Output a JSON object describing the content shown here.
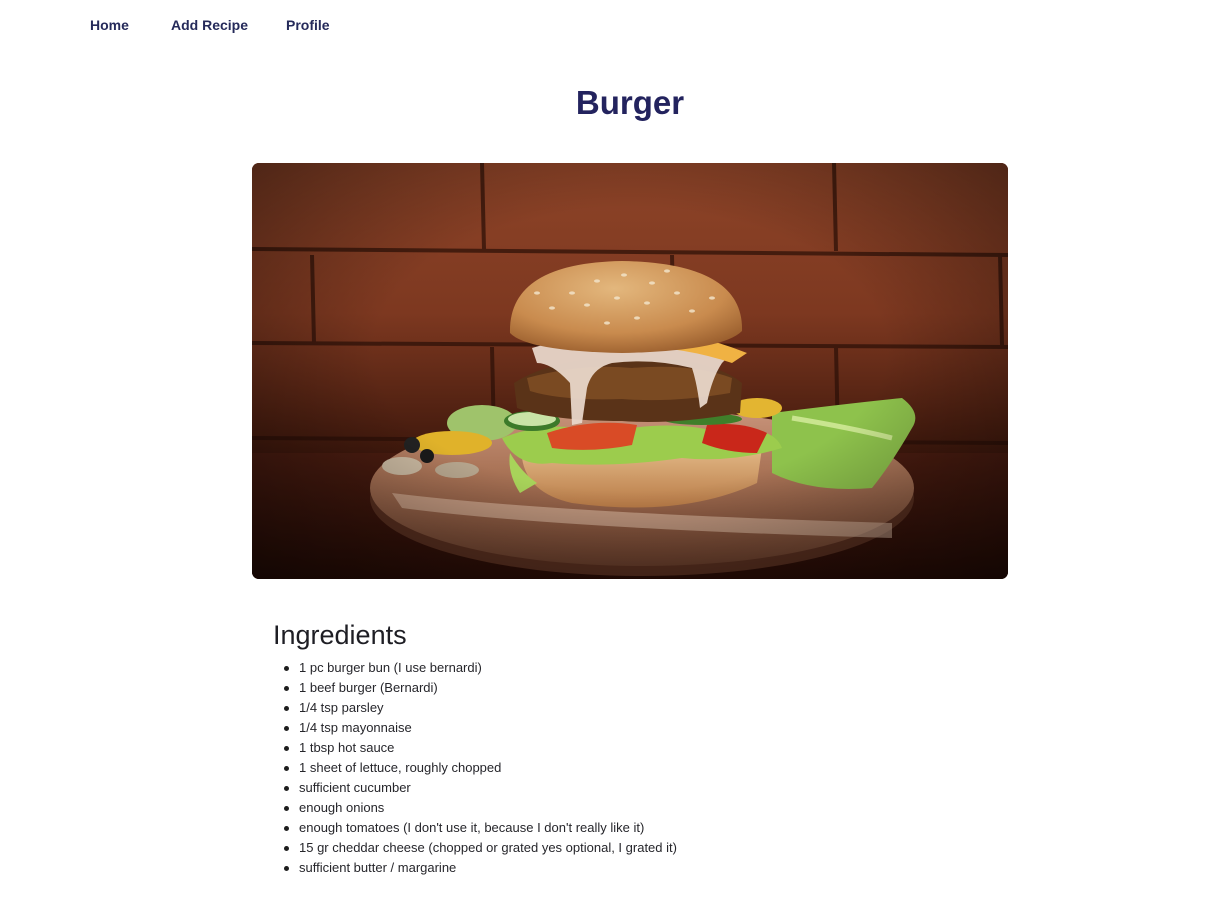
{
  "nav": {
    "home": "Home",
    "add_recipe": "Add Recipe",
    "profile": "Profile"
  },
  "recipe": {
    "title": "Burger",
    "image_subject": "burger-photo",
    "ingredients_heading": "Ingredients",
    "ingredients": [
      "1 pc burger bun (I use bernardi)",
      "1 beef burger (Bernardi)",
      "1/4 tsp parsley",
      "1/4 tsp mayonnaise",
      "1 tbsp hot sauce",
      "1 sheet of lettuce, roughly chopped",
      "sufficient cucumber",
      "enough onions",
      "enough tomatoes (I don't use it, because I don't really like it)",
      "15 gr cheddar cheese (chopped or grated yes optional, I grated it)",
      "sufficient butter / margarine"
    ]
  },
  "colors": {
    "nav_text": "#252a5a",
    "title": "#23235e",
    "body_text": "#26262b"
  }
}
